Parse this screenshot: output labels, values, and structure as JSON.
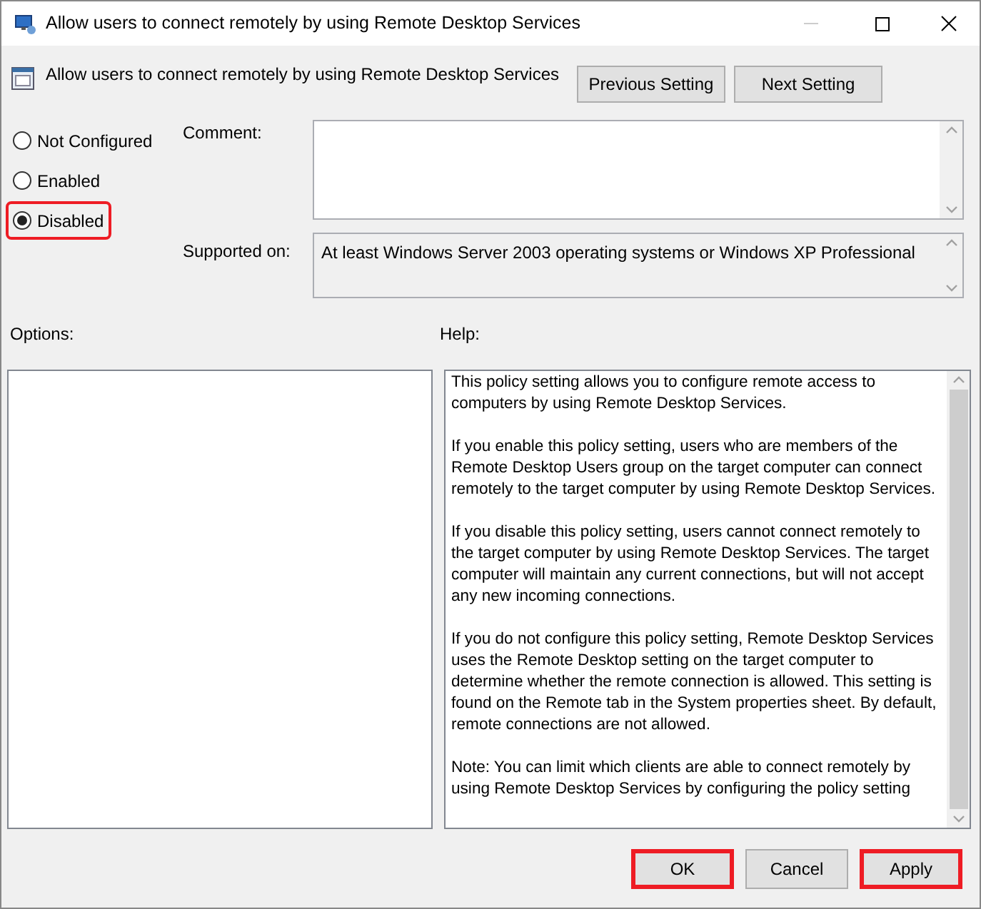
{
  "window": {
    "title": "Allow users to connect remotely by using Remote Desktop Services"
  },
  "header": {
    "setting_name": "Allow users to connect remotely by using Remote Desktop Services",
    "buttons": [
      {
        "label": "Previous Setting"
      },
      {
        "label": "Next Setting"
      }
    ]
  },
  "state_options": [
    {
      "label": "Not Configured",
      "selected": false,
      "highlighted": false
    },
    {
      "label": "Enabled",
      "selected": false,
      "highlighted": false
    },
    {
      "label": "Disabled",
      "selected": true,
      "highlighted": true
    }
  ],
  "comment": {
    "label": "Comment:"
  },
  "supported_on": {
    "label": "Supported on:",
    "value": "At least Windows Server 2003 operating systems or Windows XP Professional"
  },
  "options": {
    "label": "Options:"
  },
  "help": {
    "label": "Help:",
    "paragraphs": [
      "This policy setting allows you to configure remote access to computers by using Remote Desktop Services.",
      "If you enable this policy setting, users who are members of the Remote Desktop Users group on the target computer can connect remotely to the target computer by using Remote Desktop Services.",
      "If you disable this policy setting, users cannot connect remotely to the target computer by using Remote Desktop Services. The target computer will maintain any current connections, but will not accept any new incoming connections.",
      "If you do not configure this policy setting, Remote Desktop Services uses the Remote Desktop setting on the target computer to determine whether the remote connection is allowed. This setting is found on the Remote tab in the System properties sheet. By default, remote connections are not allowed.",
      "Note: You can limit which clients are able to connect remotely by using Remote Desktop Services by configuring the policy setting"
    ]
  },
  "footer_buttons": [
    {
      "label": "OK",
      "highlighted": true
    },
    {
      "label": "Cancel",
      "highlighted": false
    },
    {
      "label": "Apply",
      "highlighted": true
    }
  ]
}
